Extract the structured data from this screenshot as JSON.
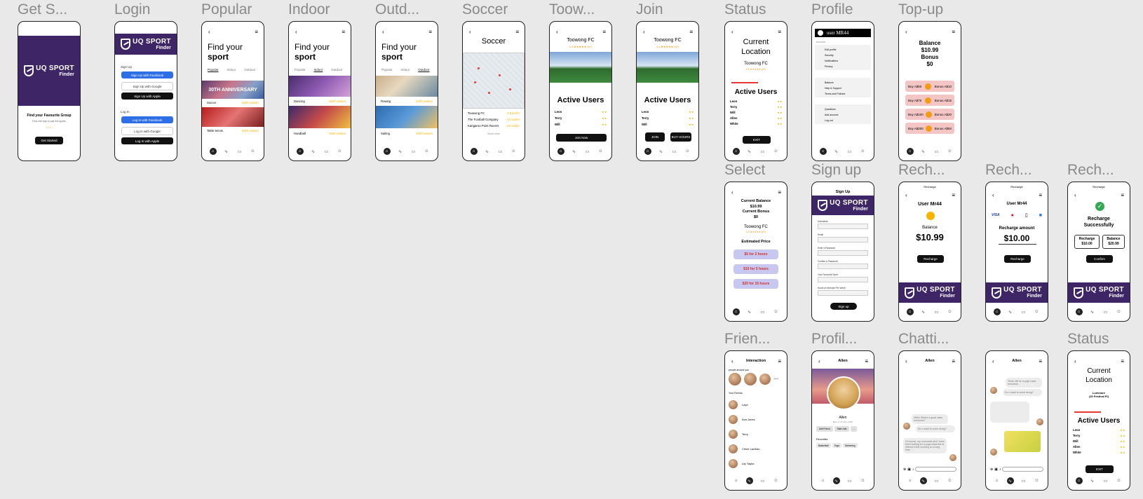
{
  "frames": {
    "getstarted": {
      "label": "Get S...",
      "logo_a": "UQ SPORT",
      "logo_b": "Finder",
      "heading": "Find your Favourite Group",
      "sub": "Find one way to pair the sports",
      "dots": "• • • •",
      "button": "Get Started"
    },
    "login": {
      "label": "Login",
      "logo_a": "UQ SPORT",
      "logo_b": "Finder",
      "signup": "Sign Up",
      "fb_signup": "Sign Up with Facebook",
      "g_signup": "Sign Up with Google",
      "a_signup": "Sign Up with Apple",
      "login": "Log In",
      "fb_login": "Log In with Facebook",
      "g_login": "Log In with Google",
      "a_login": "Log In with Apple"
    },
    "popular": {
      "label": "Popular",
      "hero1": "Find your",
      "hero2": "sport",
      "tabs": [
        "Popular",
        "Indoor",
        "Outdoor"
      ],
      "banner": "30TH ANNIVERSARY",
      "item1": "Soccer",
      "item2": "Table tennis",
      "rate": "2000 visitors"
    },
    "indoor": {
      "label": "Indoor",
      "hero1": "Find your",
      "hero2": "sport",
      "tabs": [
        "Popular",
        "Indoor",
        "Outdoor"
      ],
      "item1": "Dancing",
      "item2": "Handball",
      "rate": "1500 visitors"
    },
    "outdoor": {
      "label": "Outd...",
      "hero1": "Find your",
      "hero2": "sport",
      "tabs": [
        "Popular",
        "Indoor",
        "Outdoor"
      ],
      "item1": "Rowing",
      "item2": "Sailing",
      "rate": "1000 visitors"
    },
    "soccer": {
      "label": "Soccer",
      "title": "Soccer",
      "clubs": [
        "Toowong FC",
        "The Football Company",
        "Kangaroo Point Rovers"
      ],
      "rates": [
        "4.8 km/hr",
        "4.0 visitor",
        "3.9 visitor"
      ],
      "more": "Show more"
    },
    "toowong": {
      "label": "Toow...",
      "club": "Toowong FC",
      "rating": "4.3 ★★★★★ (87)",
      "active": "Active Users",
      "users": [
        "Leon",
        "Terry",
        "Will"
      ],
      "button": "Join Now"
    },
    "join": {
      "label": "Join",
      "club": "Toowong FC",
      "rating": "4.3 ★★★★★ (87)",
      "active": "Active Users",
      "users": [
        "Leon",
        "Terry",
        "Will"
      ],
      "b1": "JOIN",
      "b2": "BUY HOURS"
    },
    "status": {
      "label": "Status",
      "title1": "Current",
      "title2": "Location",
      "club": "Toowong FC",
      "rating": "4.8 ★★★★★ (87)",
      "active": "Active Users",
      "users": [
        "Leon",
        "Terry",
        "Will",
        "Allen",
        "White"
      ],
      "button": "EXIT"
    },
    "profile": {
      "label": "Profile",
      "user": "user MR44",
      "account": "Account",
      "items1": [
        "Edit profile",
        "Security",
        "Notifications",
        "Privacy"
      ],
      "items2": [
        "Balance",
        "Help & Support",
        "Terms and Policies"
      ],
      "items3": [
        "Questions",
        "Add account",
        "Log out"
      ]
    },
    "topup": {
      "label": "Top-up",
      "bal": "Balance",
      "bal_v": "$10.99",
      "bonus": "Bonus",
      "bonus_v": "$0",
      "rows": [
        [
          "Buy A$50",
          "Bonus A$10"
        ],
        [
          "Buy A$75",
          "Bonus A$15"
        ],
        [
          "Buy A$100",
          "Bonus A$20"
        ],
        [
          "Buy A$200",
          "Bonus A$50"
        ]
      ]
    },
    "select": {
      "label": "Select",
      "cb": "Current Balance",
      "cb_v": "$10.99",
      "bo": "Current Bonus",
      "bo_v": "$0",
      "club": "Toowong FC",
      "rating": "4.3 ★★★★★ (87)",
      "est": "Estimated Price",
      "prices": [
        "$5 for 2 hours",
        "$10 for 5 hours",
        "$20 for 15 hours"
      ]
    },
    "signup": {
      "label": "Sign up",
      "title": "Sign Up",
      "logo_a": "UQ SPORT",
      "logo_b": "Finder",
      "fields": [
        "Username",
        "Email",
        "Enter a Password",
        "Confirm a Password",
        "Your Favourite Sport",
        "Hours of exercise Per Week"
      ],
      "button": "Sign up"
    },
    "rech1": {
      "label": "Rech...",
      "title": "Recharge",
      "user": "User Mr44",
      "bal": "Balance",
      "bal_v": "$10.99",
      "button": "Recharge",
      "logo_a": "UQ SPORT",
      "logo_b": "Finder"
    },
    "rech2": {
      "label": "Rech...",
      "title": "Recharge",
      "user": "User Mr44",
      "cards": "VISA",
      "amt": "Recharge amount",
      "amt_v": "$10.00",
      "button": "Recharge",
      "logo_a": "UQ SPORT",
      "logo_b": "Finder"
    },
    "rech3": {
      "label": "Rech...",
      "title": "Recharge",
      "ok1": "Recharge",
      "ok2": "Successfully",
      "r": "Recharge",
      "r_v": "$10.00",
      "b": "Balance",
      "b_v": "$20.99",
      "button": "Confirm",
      "logo_a": "UQ SPORT",
      "logo_b": "Finder"
    },
    "friend": {
      "label": "Frien...",
      "title": "Interaction",
      "pym": "people around you",
      "yf": "Your Friends",
      "friends": [
        "Layo",
        "Ava Jones",
        "Terry",
        "Chloe Lachlan",
        "Lily Taylor"
      ]
    },
    "profil": {
      "label": "Profil...",
      "title": "Allen",
      "name": "Allen",
      "sub": "Born in 15 June 1997",
      "b1": "Add Friend",
      "b2": "Start chat",
      "fav": "Favourites",
      "tags": [
        "Basketball",
        "Yoga",
        "Swimming"
      ]
    },
    "chat1": {
      "label": "Chatti...",
      "title": "Allen",
      "m1": "Hello! What's a good class tomorrow?",
      "m2": "Do u want to come along?",
      "m3": "Of course, my roommate and I have been looking for a yoga class this is offered in the morning so a long time."
    },
    "chat2": {
      "title": "Allen",
      "m1": "There will be a yoga class tomorrow...",
      "m2": "Do u want to come along?"
    },
    "status2": {
      "label": "Status",
      "title1": "Current",
      "title2": "Location",
      "club": "Luminare",
      "club2": "(20 Festival Pl)",
      "active": "Active Users",
      "users": [
        "Leon",
        "Terry",
        "Will",
        "Allen",
        "White"
      ],
      "button": "EXIT"
    }
  }
}
